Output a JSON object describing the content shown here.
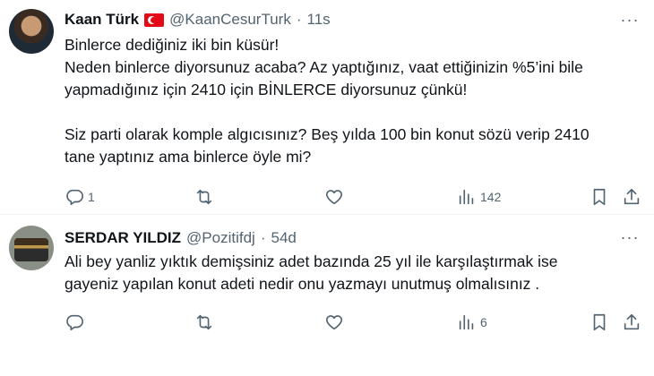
{
  "tweets": [
    {
      "author_name": "Kaan Türk",
      "handle": "@KaanCesurTurk",
      "separator": "·",
      "time": "11s",
      "lines": [
        "Binlerce dediğiniz iki bin küsür!",
        "Neden binlerce diyorsunuz acaba? Az yaptığınız, vaat ettiğinizin %5’ini bile",
        "yapmadığınız için 2410 için BİNLERCE diyorsunuz çünkü!",
        "",
        "Siz parti olarak komple algıcısınız? Beş yılda 100 bin konut sözü verip 2410",
        "tane yaptınız ama binlerce öyle mi?"
      ],
      "reply_count": "1",
      "retweet_count": "",
      "like_count": "",
      "view_count": "142"
    },
    {
      "author_name": "SERDAR YILDIZ",
      "handle": "@Pozitifdj",
      "separator": "·",
      "time": "54d",
      "lines": [
        "Ali bey yanliz yıktık demişsiniz adet bazında 25 yıl ile karşılaştırmak ise",
        "gayeniz yapılan konut adeti nedir onu yazmayı unutmuş olmalısınız ."
      ],
      "reply_count": "",
      "retweet_count": "",
      "like_count": "",
      "view_count": "6"
    }
  ],
  "icons": {
    "more": "more-dots-icon",
    "reply": "reply-icon",
    "retweet": "retweet-icon",
    "like": "heart-icon",
    "views": "views-icon",
    "bookmark": "bookmark-icon",
    "share": "share-icon",
    "flag": "turkey-flag-icon"
  },
  "colors": {
    "text": "#0f1419",
    "secondary": "#536471",
    "divider": "#eff3f4"
  }
}
